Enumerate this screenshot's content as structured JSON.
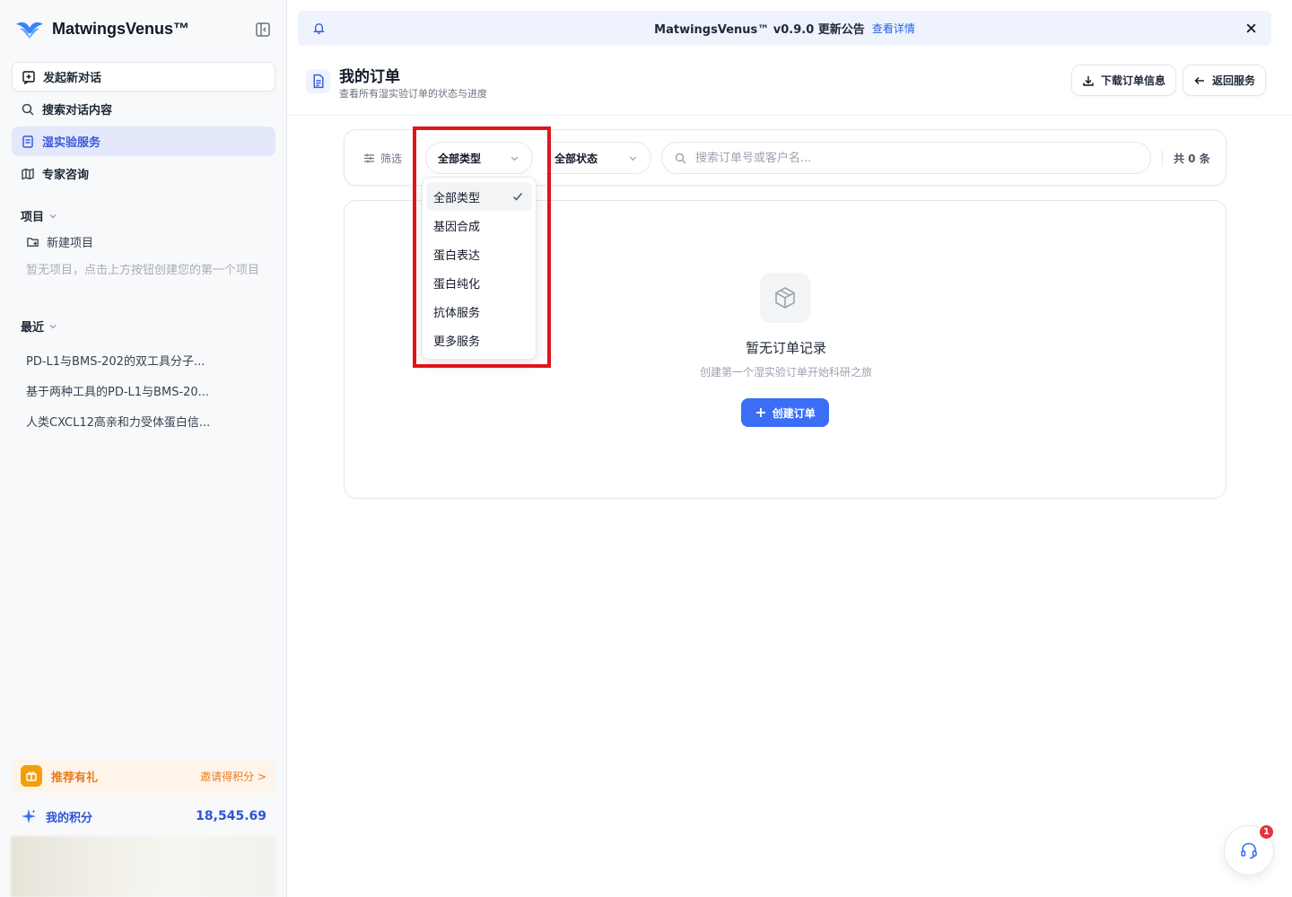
{
  "app": {
    "name": "MatwingsVenus™"
  },
  "sidebar": {
    "nav": [
      {
        "label": "发起新对话",
        "icon": "message-plus-icon"
      },
      {
        "label": "搜索对话内容",
        "icon": "search-icon"
      },
      {
        "label": "湿实验服务",
        "icon": "flask-icon"
      },
      {
        "label": "专家咨询",
        "icon": "map-icon"
      }
    ],
    "projects": {
      "title": "项目",
      "new_label": "新建项目",
      "empty_text": "暂无项目，点击上方按钮创建您的第一个项目"
    },
    "recent": {
      "title": "最近",
      "items": [
        "PD-L1与BMS-202的双工具分子...",
        "基于两种工具的PD-L1与BMS-20...",
        "人类CXCL12高亲和力受体蛋白信..."
      ]
    },
    "referral": {
      "label": "推荐有礼",
      "link": "邀请得积分 >"
    },
    "points": {
      "label": "我的积分",
      "value": "18,545.69"
    }
  },
  "banner": {
    "text": "MatwingsVenus™ v0.9.0 更新公告",
    "link": "查看详情"
  },
  "page": {
    "title": "我的订单",
    "subtitle": "查看所有湿实验订单的状态与进度",
    "download_label": "下载订单信息",
    "back_label": "返回服务"
  },
  "filters": {
    "label": "筛选",
    "type_value": "全部类型",
    "status_value": "全部状态",
    "search_placeholder": "搜索订单号或客户名...",
    "count_text": "共 0 条"
  },
  "type_dropdown": {
    "selected": "全部类型",
    "options": [
      "全部类型",
      "基因合成",
      "蛋白表达",
      "蛋白纯化",
      "抗体服务",
      "更多服务"
    ]
  },
  "empty_state": {
    "title": "暂无订单记录",
    "subtitle": "创建第一个湿实验订单开始科研之旅",
    "button": "创建订单"
  },
  "support": {
    "badge": "1"
  },
  "colors": {
    "accent": "#3b6ef5",
    "active_nav": "#e3e8fb",
    "highlight_border": "#e0141b",
    "referral": "#ea7b19"
  }
}
